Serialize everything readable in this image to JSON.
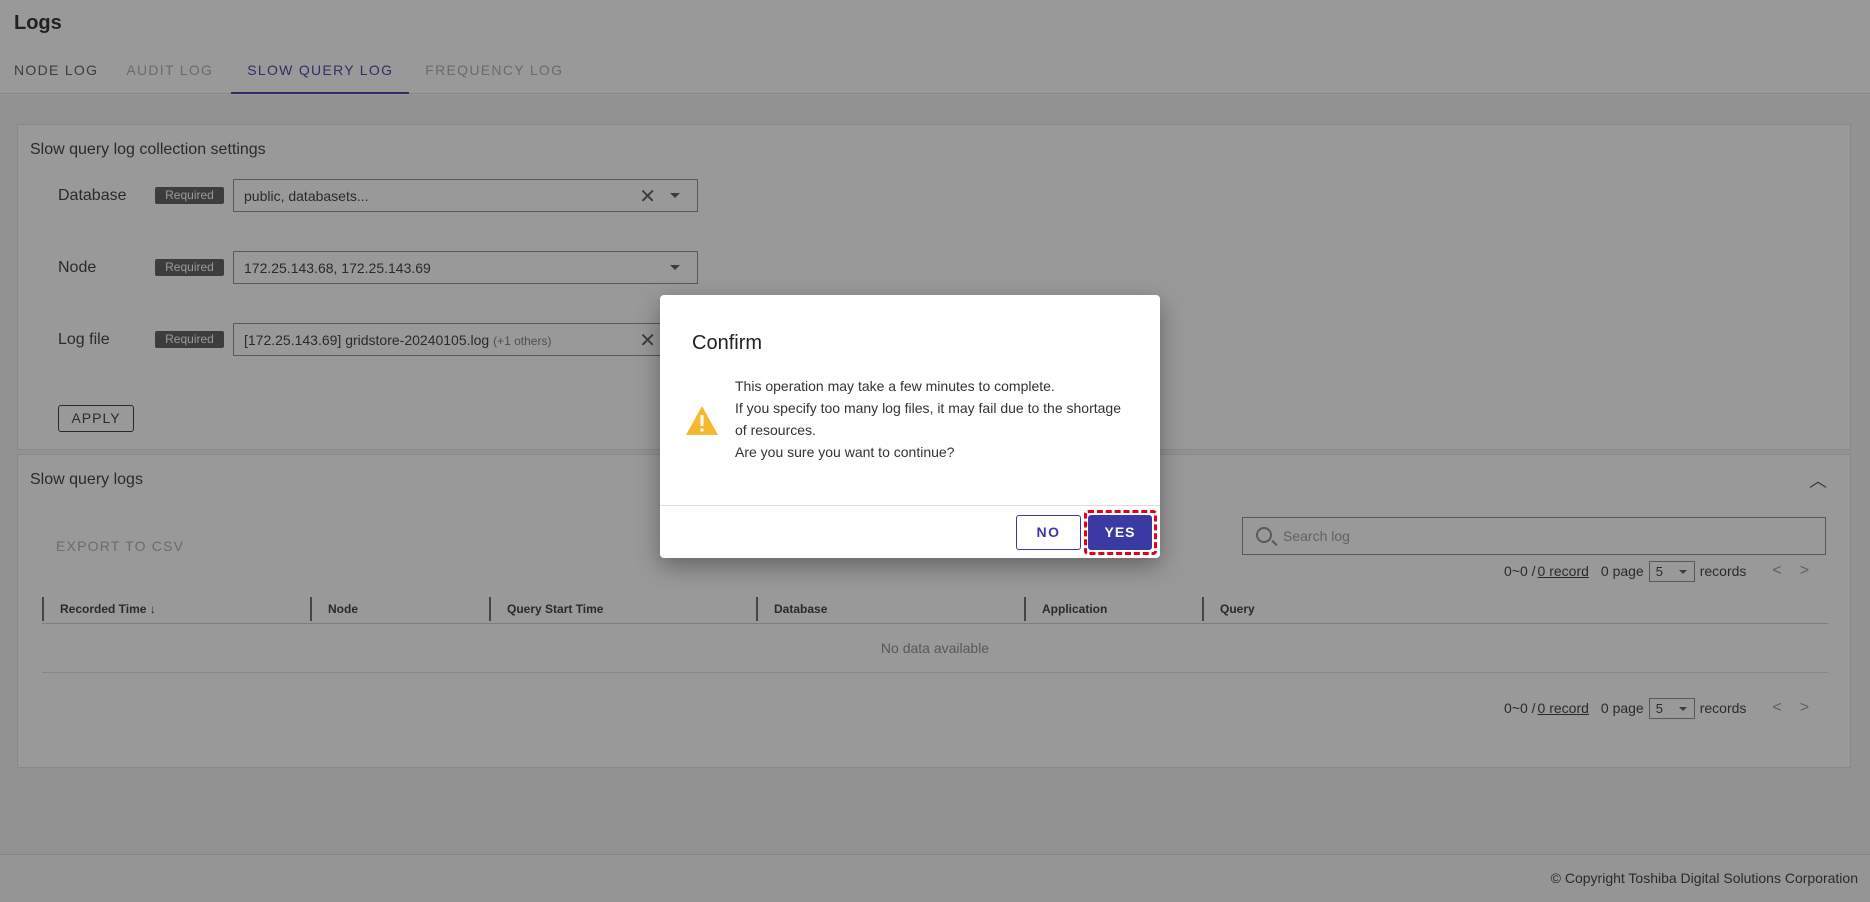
{
  "header": {
    "title": "Logs",
    "tabs": [
      {
        "label": "NODE LOG",
        "state": "normal"
      },
      {
        "label": "AUDIT LOG",
        "state": "disabled"
      },
      {
        "label": "SLOW QUERY LOG",
        "state": "active"
      },
      {
        "label": "FREQUENCY LOG",
        "state": "disabled"
      }
    ]
  },
  "settings": {
    "title": "Slow query log collection settings",
    "required_label": "Required",
    "fields": [
      {
        "label": "Database",
        "value": "public, databasets...",
        "clearable": true
      },
      {
        "label": "Node",
        "value": "172.25.143.68, 172.25.143.69",
        "clearable": false
      },
      {
        "label": "Log file",
        "value": "[172.25.143.69] gridstore-20240105.log",
        "extra": "(+1 others)",
        "clearable": true
      }
    ],
    "apply_label": "APPLY"
  },
  "logs": {
    "title": "Slow query logs",
    "export_label": "EXPORT TO CSV",
    "search_placeholder": "Search log",
    "pager": {
      "range": "0~0 / ",
      "record_link": "0 record",
      "page": "0 page",
      "per_page": "5",
      "records_label": "records"
    },
    "columns": [
      "Recorded Time",
      "Node",
      "Query Start Time",
      "Database",
      "Application",
      "Query"
    ],
    "sort_indicator": "↓",
    "empty_text": "No data available"
  },
  "footer": {
    "copyright": "© Copyright Toshiba Digital Solutions Corporation"
  },
  "dialog": {
    "title": "Confirm",
    "icon": "warning-icon",
    "message_lines": [
      "This operation may take a few minutes to complete.",
      "If you specify too many log files, it may fail due to the shortage of resources.",
      "Are you sure you want to continue?"
    ],
    "no_label": "NO",
    "yes_label": "YES",
    "highlight_color": "#e0001a"
  },
  "colors": {
    "accent": "#3b3aa3",
    "warning": "#f5b82e"
  }
}
